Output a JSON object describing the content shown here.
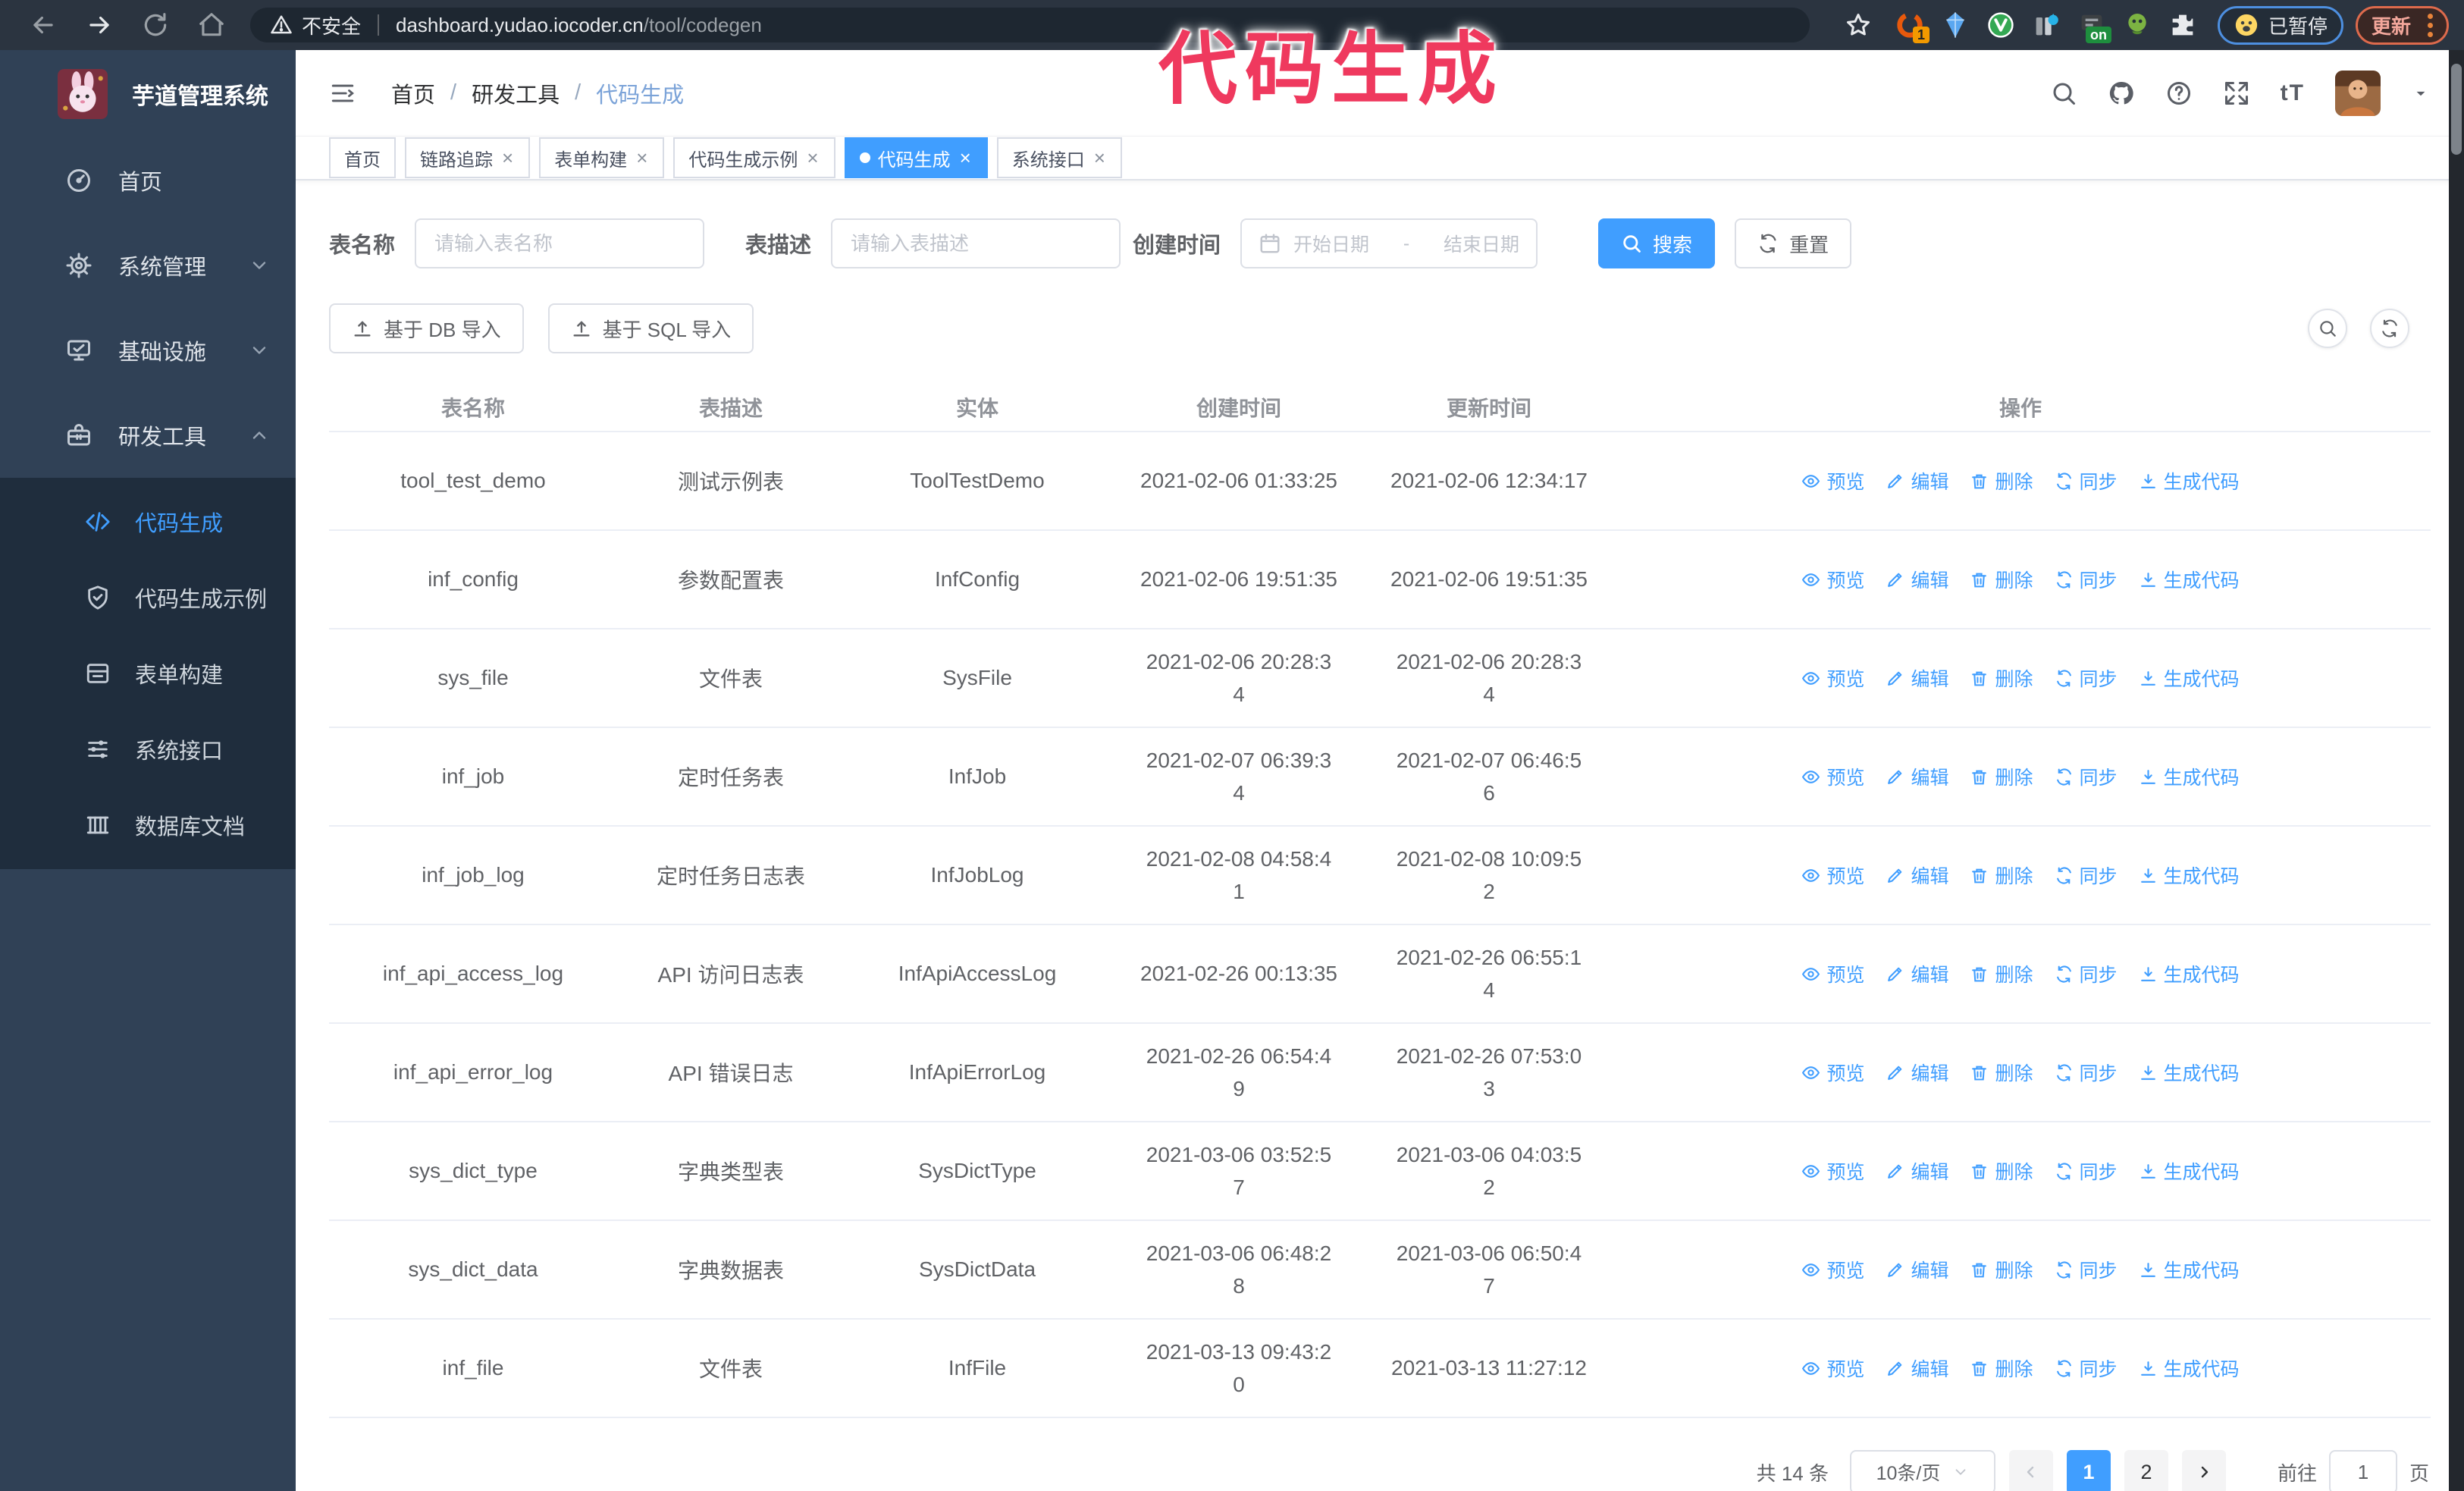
{
  "browser": {
    "security_label": "不安全",
    "url_host": "dashboard.yudao.iocoder.cn",
    "url_path": "/tool/codegen",
    "ext_badge_count": "1",
    "ext_badge_on": "on",
    "paused_badge": "已暂停",
    "update_badge": "更新"
  },
  "overlay": {
    "text": "代码生成",
    "color": "#ef395e"
  },
  "sidebar": {
    "title": "芋道管理系统",
    "items": [
      {
        "label": "首页"
      },
      {
        "label": "系统管理"
      },
      {
        "label": "基础设施"
      },
      {
        "label": "研发工具"
      }
    ],
    "subitems": [
      {
        "label": "代码生成",
        "active": true
      },
      {
        "label": "代码生成示例"
      },
      {
        "label": "表单构建"
      },
      {
        "label": "系统接口"
      },
      {
        "label": "数据库文档"
      }
    ]
  },
  "header": {
    "breadcrumb": [
      "首页",
      "研发工具",
      "代码生成"
    ],
    "breadcrumb_separator": "/",
    "font_size_icon_label": "tT"
  },
  "tabs": [
    {
      "label": "首页"
    },
    {
      "label": "链路追踪"
    },
    {
      "label": "表单构建"
    },
    {
      "label": "代码生成示例"
    },
    {
      "label": "代码生成",
      "active": true
    },
    {
      "label": "系统接口"
    }
  ],
  "glyphs": {
    "close": "×",
    "caret": "▾"
  },
  "filters": {
    "table_name_label": "表名称",
    "table_name_placeholder": "请输入表名称",
    "table_desc_label": "表描述",
    "table_desc_placeholder": "请输入表描述",
    "create_time_label": "创建时间",
    "date_start_placeholder": "开始日期",
    "date_separator": "-",
    "date_end_placeholder": "结束日期",
    "search_label": "搜索",
    "reset_label": "重置"
  },
  "toolbar": {
    "import_db_label": "基于 DB 导入",
    "import_sql_label": "基于 SQL 导入"
  },
  "table": {
    "columns": [
      "表名称",
      "表描述",
      "实体",
      "创建时间",
      "更新时间",
      "操作"
    ],
    "actions": [
      "预览",
      "编辑",
      "删除",
      "同步",
      "生成代码"
    ],
    "rows": [
      {
        "name": "tool_test_demo",
        "desc": "测试示例表",
        "entity": "ToolTestDemo",
        "created": [
          "2021-02-06 01:33:25"
        ],
        "updated": [
          "2021-02-06 12:34:17"
        ]
      },
      {
        "name": "inf_config",
        "desc": "参数配置表",
        "entity": "InfConfig",
        "created": [
          "2021-02-06 19:51:35"
        ],
        "updated": [
          "2021-02-06 19:51:35"
        ]
      },
      {
        "name": "sys_file",
        "desc": "文件表",
        "entity": "SysFile",
        "created": [
          "2021-02-06 20:28:3",
          "4"
        ],
        "updated": [
          "2021-02-06 20:28:3",
          "4"
        ]
      },
      {
        "name": "inf_job",
        "desc": "定时任务表",
        "entity": "InfJob",
        "created": [
          "2021-02-07 06:39:3",
          "4"
        ],
        "updated": [
          "2021-02-07 06:46:5",
          "6"
        ]
      },
      {
        "name": "inf_job_log",
        "desc": "定时任务日志表",
        "entity": "InfJobLog",
        "created": [
          "2021-02-08 04:58:4",
          "1"
        ],
        "updated": [
          "2021-02-08 10:09:5",
          "2"
        ]
      },
      {
        "name": "inf_api_access_log",
        "desc": "API 访问日志表",
        "entity": "InfApiAccessLog",
        "created": [
          "2021-02-26 00:13:35"
        ],
        "updated": [
          "2021-02-26 06:55:1",
          "4"
        ]
      },
      {
        "name": "inf_api_error_log",
        "desc": "API 错误日志",
        "entity": "InfApiErrorLog",
        "created": [
          "2021-02-26 06:54:4",
          "9"
        ],
        "updated": [
          "2021-02-26 07:53:0",
          "3"
        ]
      },
      {
        "name": "sys_dict_type",
        "desc": "字典类型表",
        "entity": "SysDictType",
        "created": [
          "2021-03-06 03:52:5",
          "7"
        ],
        "updated": [
          "2021-03-06 04:03:5",
          "2"
        ]
      },
      {
        "name": "sys_dict_data",
        "desc": "字典数据表",
        "entity": "SysDictData",
        "created": [
          "2021-03-06 06:48:2",
          "8"
        ],
        "updated": [
          "2021-03-06 06:50:4",
          "7"
        ]
      },
      {
        "name": "inf_file",
        "desc": "文件表",
        "entity": "InfFile",
        "created": [
          "2021-03-13 09:43:2",
          "0"
        ],
        "updated": [
          "2021-03-13 11:27:12"
        ]
      }
    ]
  },
  "pagination": {
    "total": "共 14 条",
    "page_size": "10条/页",
    "page_1": "1",
    "page_2": "2",
    "goto_label": "前往",
    "goto_value": "1",
    "goto_suffix": "页"
  },
  "colors": {
    "accent": "#409eff",
    "sidebar_bg": "#304156",
    "submenu_bg": "#1f2d3d",
    "overlay_pink": "#ef395e"
  }
}
